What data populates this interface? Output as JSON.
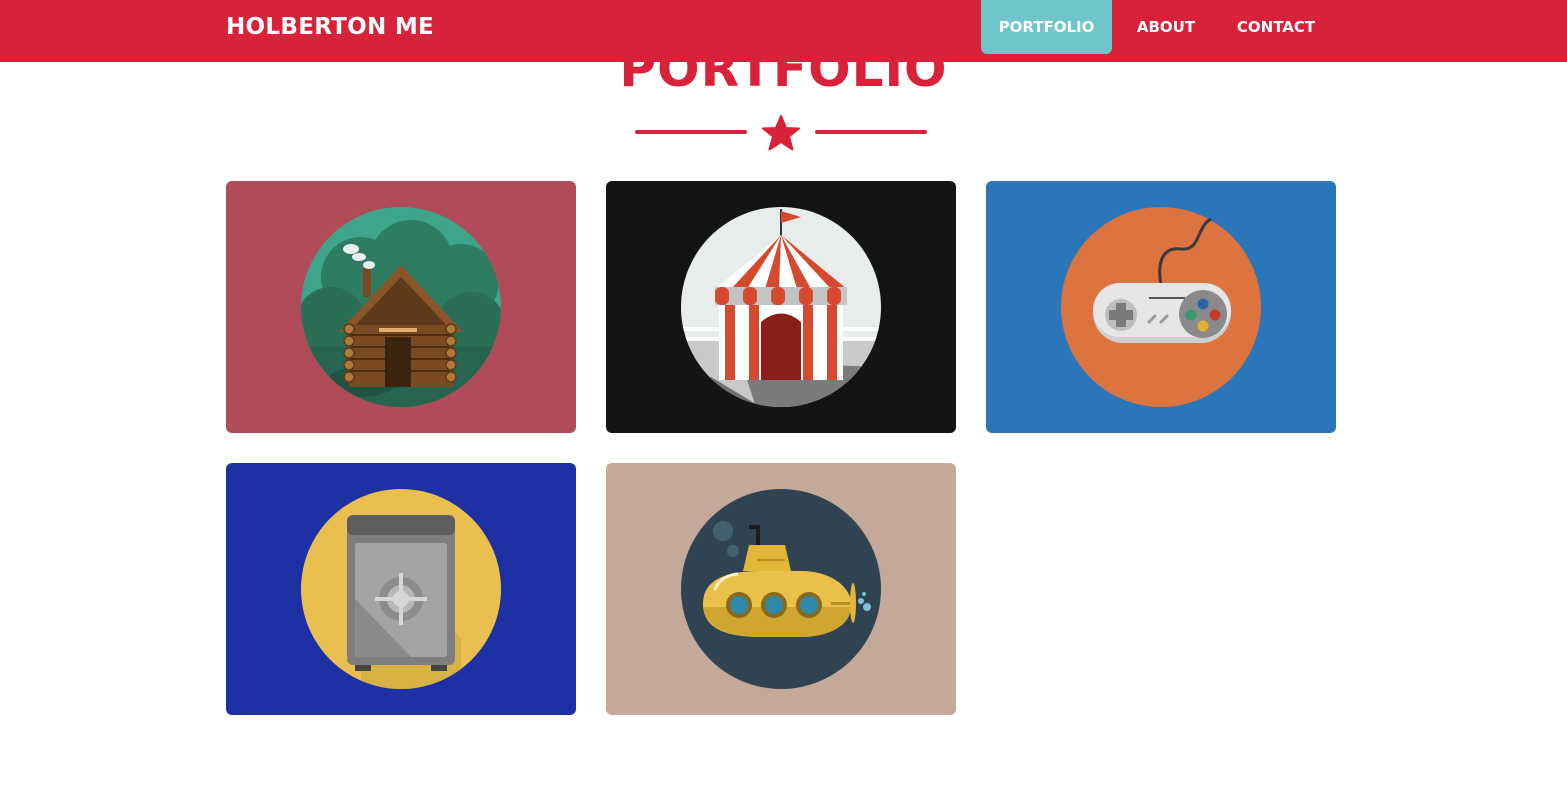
{
  "navbar": {
    "brand": "HOLBERTON ME",
    "links": [
      {
        "label": "PORTFOLIO",
        "active": true
      },
      {
        "label": "ABOUT",
        "active": false
      },
      {
        "label": "CONTACT",
        "active": false
      }
    ]
  },
  "portfolio": {
    "title": "PORTFOLIO",
    "divider_icon": "star-icon",
    "items": [
      {
        "icon": "cabin-icon",
        "background": "#b04b5a",
        "circle": "#3fa58a"
      },
      {
        "icon": "circus-tent-icon",
        "background": "#141414",
        "circle": "#e8eced"
      },
      {
        "icon": "game-controller-icon",
        "background": "#2a76b8",
        "circle": "#dd743f"
      },
      {
        "icon": "safe-icon",
        "background": "#1d30a4",
        "circle": "#e9c050"
      },
      {
        "icon": "submarine-icon",
        "background": "#c4a99a",
        "circle": "#2f4352"
      }
    ]
  },
  "colors": {
    "primary": "#d9223a",
    "accent": "#6ec6ca"
  }
}
